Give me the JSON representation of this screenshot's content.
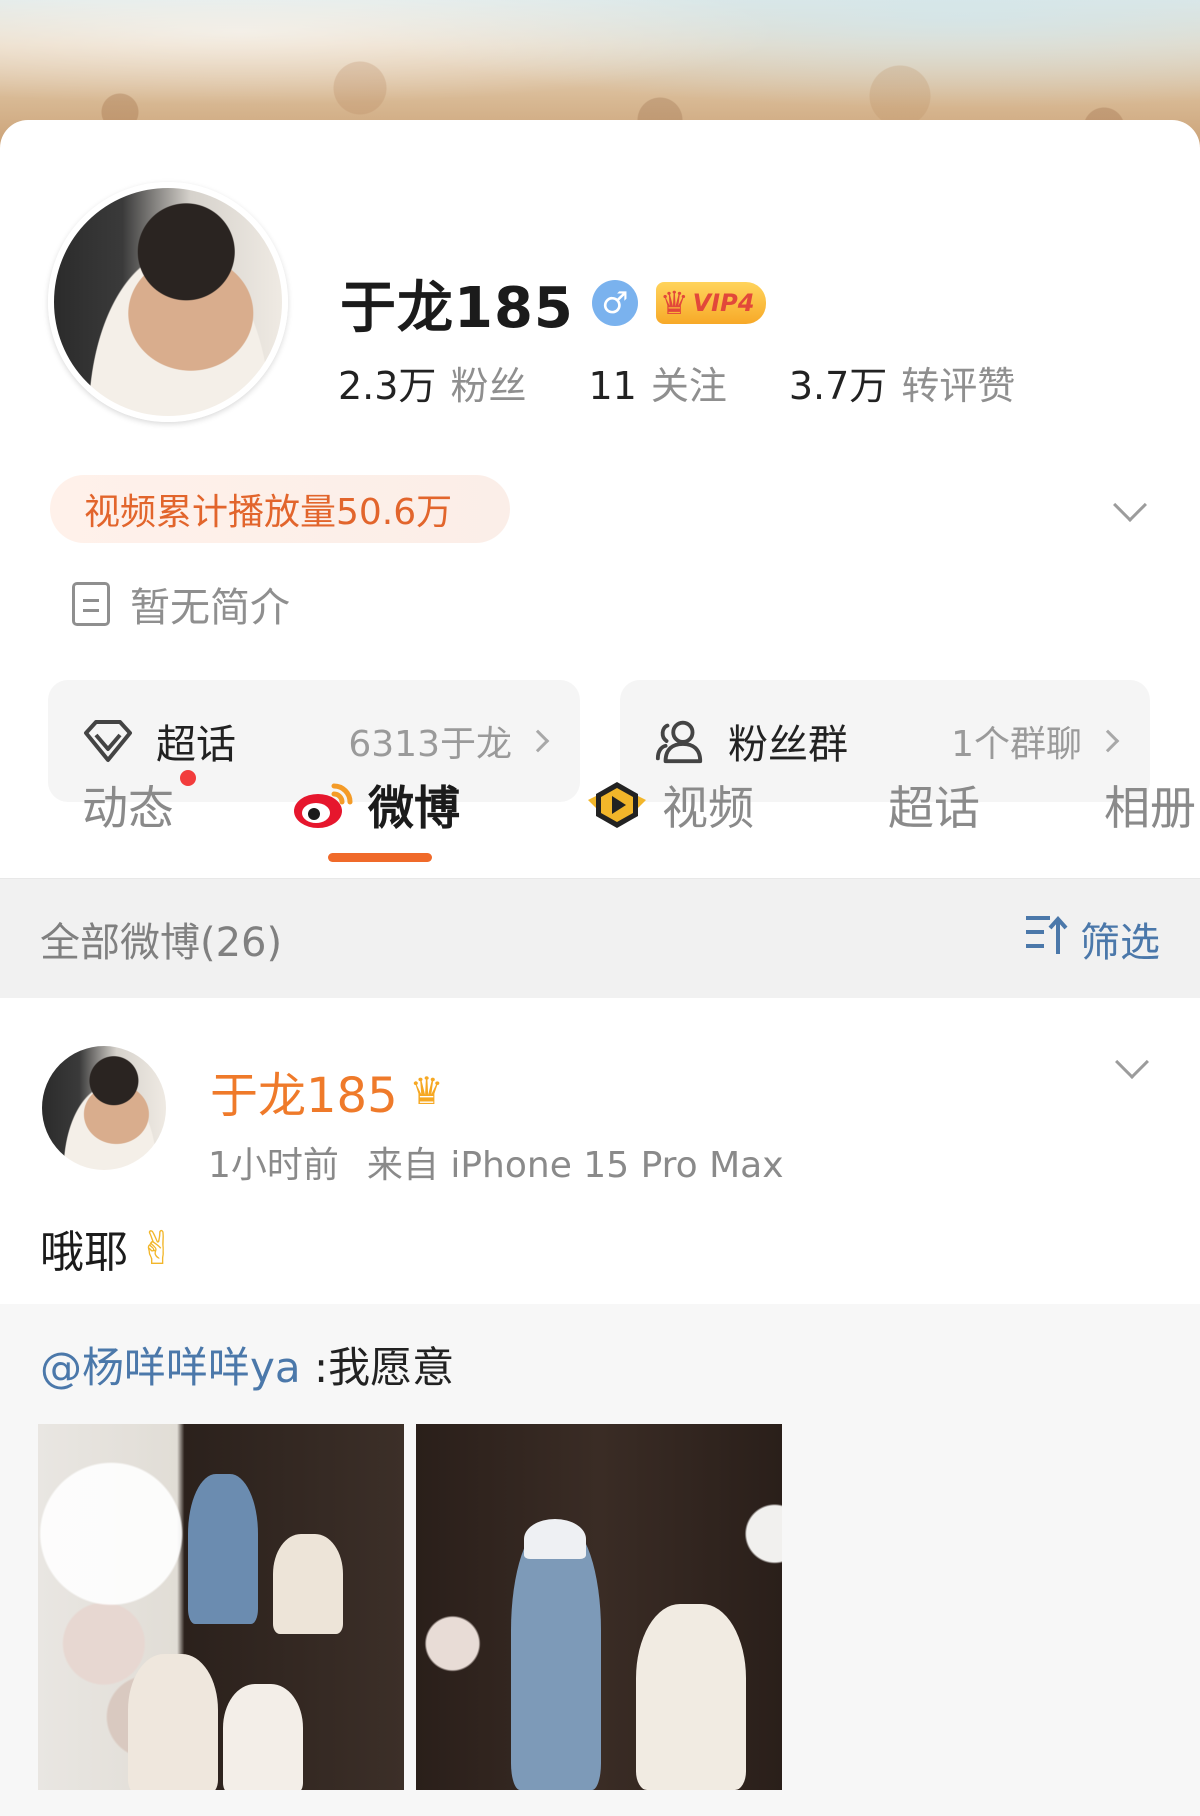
{
  "profile": {
    "name": "于龙185",
    "gender_icon": "male-icon",
    "vip_label": "VIP4",
    "stats": [
      {
        "value": "2.3万",
        "label": "粉丝"
      },
      {
        "value": "11",
        "label": "关注"
      },
      {
        "value": "3.7万",
        "label": "转评赞"
      }
    ],
    "promo": "视频累计播放量50.6万",
    "bio": "暂无简介",
    "quick_cards": [
      {
        "title": "超话",
        "value": "6313于龙",
        "icon": "diamond-icon"
      },
      {
        "title": "粉丝群",
        "value": "1个群聊",
        "icon": "people-icon"
      }
    ]
  },
  "tabs": [
    {
      "label": "动态",
      "active": false,
      "has_dot": true
    },
    {
      "label": "微博",
      "active": true,
      "icon": "weibo-icon"
    },
    {
      "label": "视频",
      "active": false,
      "icon": "video-play-icon"
    },
    {
      "label": "超话",
      "active": false
    },
    {
      "label": "相册",
      "active": false
    }
  ],
  "filter_bar": {
    "all_label": "全部微博(26)",
    "filter_label": "筛选"
  },
  "post": {
    "author": "于龙185",
    "time": "1小时前",
    "source": "来自 iPhone 15 Pro Max",
    "text": "哦耶",
    "emoji": "✌",
    "repost": {
      "mention": "@杨咩咩咩ya",
      "quote": " :我愿意"
    }
  },
  "colors": {
    "accent_orange": "#f06a2a",
    "link_blue": "#4b78aa",
    "vip_gold": "#f7a928"
  }
}
